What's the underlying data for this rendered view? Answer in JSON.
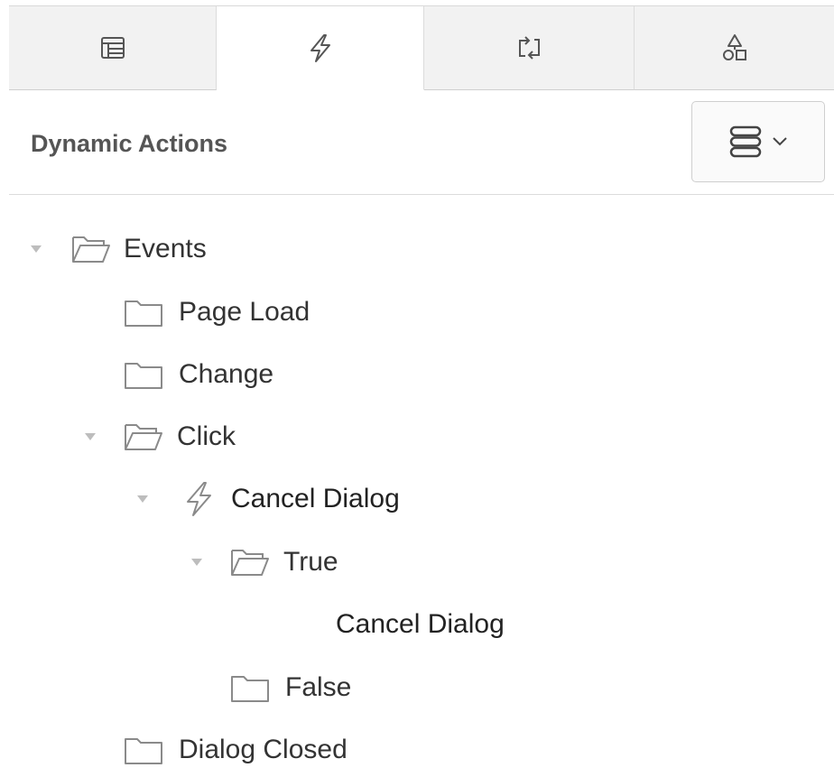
{
  "tabs": [
    {
      "icon": "layout-icon",
      "active": false
    },
    {
      "icon": "lightning-icon",
      "active": true
    },
    {
      "icon": "transfer-icon",
      "active": false
    },
    {
      "icon": "shapes-icon",
      "active": false
    }
  ],
  "panel": {
    "title": "Dynamic Actions",
    "menu_icon": "stack-icon"
  },
  "tree": [
    {
      "label": "Events",
      "icon": "open-folder-icon",
      "expanded": true,
      "level": 0
    },
    {
      "label": "Page Load",
      "icon": "folder-icon",
      "expanded": false,
      "level": 1
    },
    {
      "label": "Change",
      "icon": "folder-icon",
      "expanded": false,
      "level": 1
    },
    {
      "label": "Click",
      "icon": "open-folder-icon",
      "expanded": true,
      "level": 1
    },
    {
      "label": "Cancel Dialog",
      "icon": "lightning-icon",
      "expanded": true,
      "level": 2
    },
    {
      "label": "True",
      "icon": "open-folder-icon",
      "expanded": true,
      "level": 3
    },
    {
      "label": "Cancel Dialog",
      "icon": "",
      "expanded": false,
      "level": 4
    },
    {
      "label": "False",
      "icon": "folder-icon",
      "expanded": false,
      "level": 3
    },
    {
      "label": "Dialog Closed",
      "icon": "folder-icon",
      "expanded": false,
      "level": 1
    }
  ]
}
